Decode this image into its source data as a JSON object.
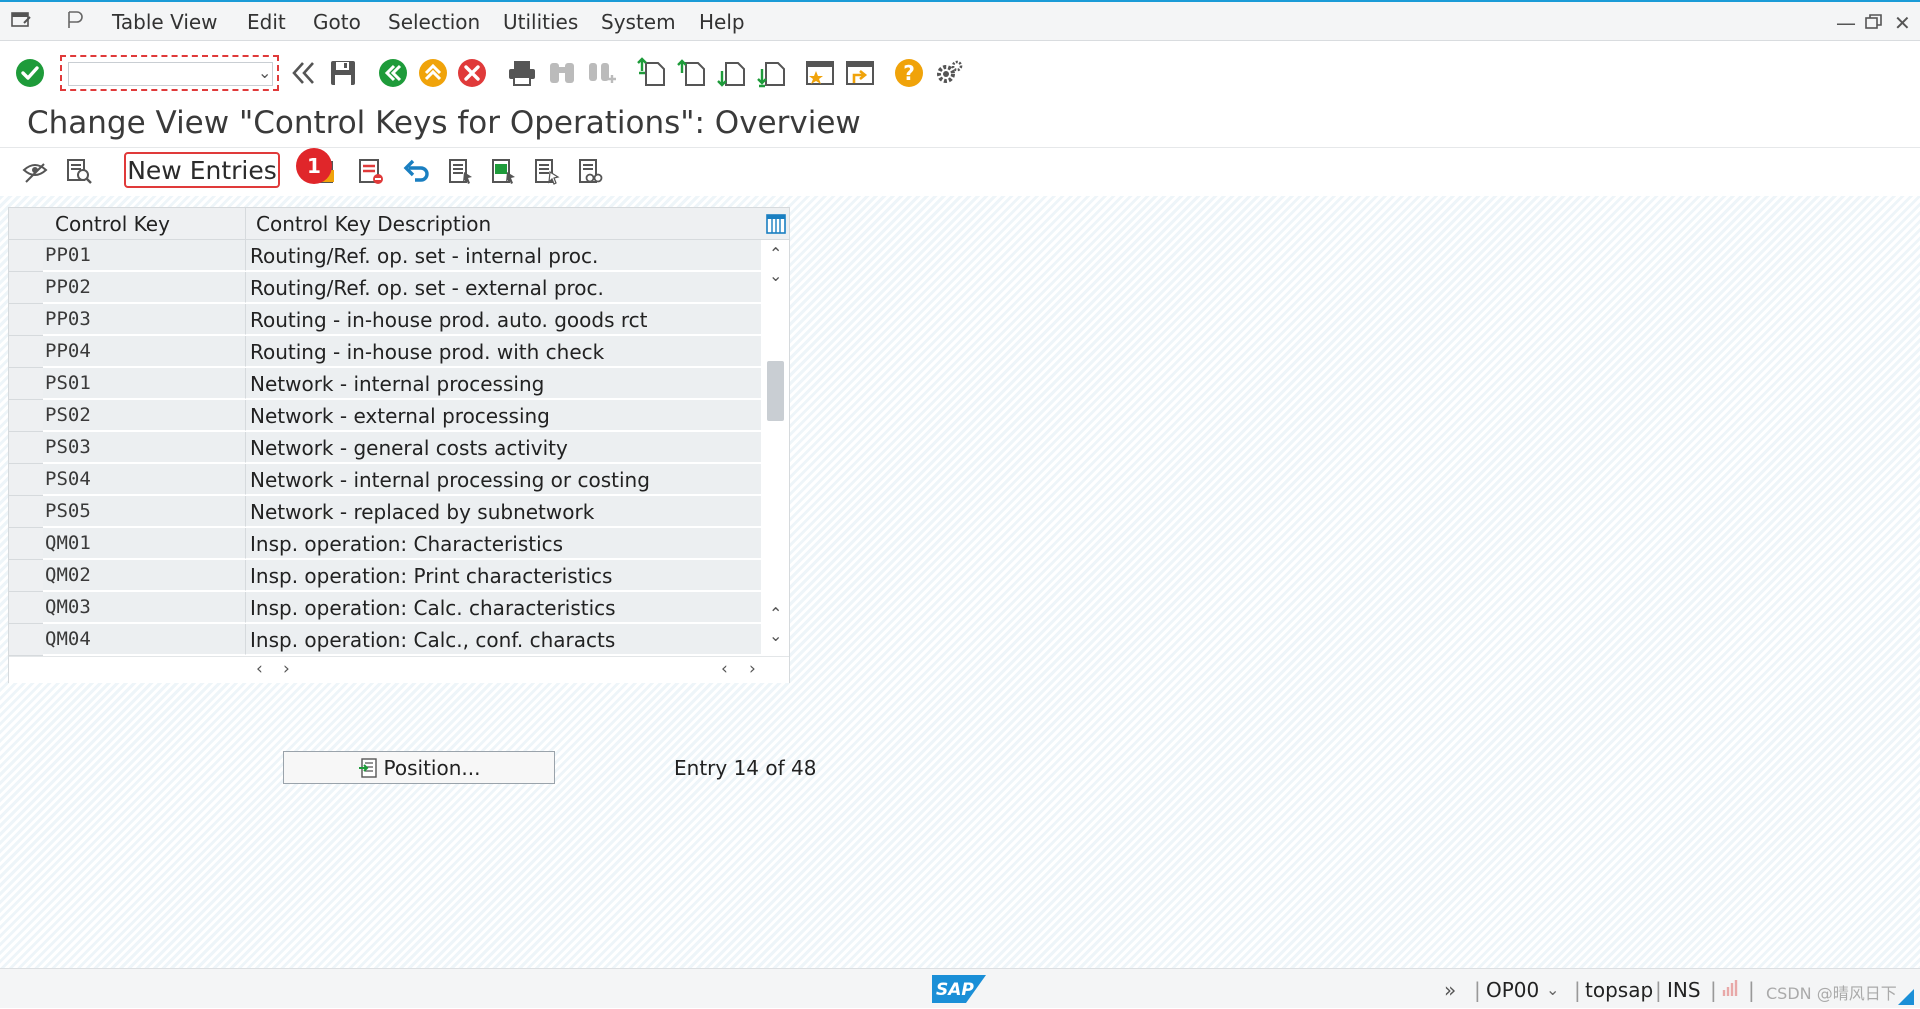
{
  "menu": {
    "items": [
      "Table View",
      "Edit",
      "Goto",
      "Selection",
      "Utilities",
      "System",
      "Help"
    ]
  },
  "window_controls": [
    "minimize-icon",
    "restore-icon",
    "close-icon"
  ],
  "toolbar": {
    "command_field_value": "",
    "icons": [
      "enter-icon",
      "command-dropdown-icon",
      "expand-icon",
      "save-icon",
      "back-icon",
      "exit-icon",
      "cancel-icon",
      "print-icon",
      "find-icon",
      "find-next-icon",
      "first-page-icon",
      "previous-page-icon",
      "next-page-icon",
      "last-page-icon",
      "create-shortcut-icon",
      "new-session-icon",
      "help-icon",
      "settings-icon"
    ]
  },
  "title": "Change View \"Control Keys for Operations\": Overview",
  "app_toolbar": {
    "new_entries_label": "New Entries",
    "step_badge": "1"
  },
  "table": {
    "columns": [
      "Control Key",
      "Control Key Description"
    ],
    "rows": [
      {
        "key": "PP01",
        "description": "Routing/Ref. op. set - internal proc."
      },
      {
        "key": "PP02",
        "description": "Routing/Ref. op. set - external proc."
      },
      {
        "key": "PP03",
        "description": "Routing - in-house prod. auto. goods rct"
      },
      {
        "key": "PP04",
        "description": "Routing - in-house prod. with check"
      },
      {
        "key": "PS01",
        "description": "Network - internal processing"
      },
      {
        "key": "PS02",
        "description": "Network - external processing"
      },
      {
        "key": "PS03",
        "description": "Network - general costs activity"
      },
      {
        "key": "PS04",
        "description": "Network - internal processing or costing"
      },
      {
        "key": "PS05",
        "description": "Network - replaced by subnetwork"
      },
      {
        "key": "QM01",
        "description": "Insp. operation: Characteristics"
      },
      {
        "key": "QM02",
        "description": "Insp. operation: Print characteristics"
      },
      {
        "key": "QM03",
        "description": "Insp. operation: Calc. characteristics"
      },
      {
        "key": "QM04",
        "description": "Insp. operation: Calc., conf. characts"
      }
    ]
  },
  "position_button_label": "Position...",
  "entry_info": "Entry 14 of 48",
  "status_bar": {
    "logo": "SAP",
    "transaction": "OP00",
    "system": "topsap",
    "mode": "INS",
    "watermark": "CSDN @晴风日下"
  },
  "colors": {
    "accent_blue": "#1a9bd7",
    "highlight_red": "#e03a3a",
    "ok_green": "#1e9b3a",
    "warn_orange": "#f0a30a"
  }
}
